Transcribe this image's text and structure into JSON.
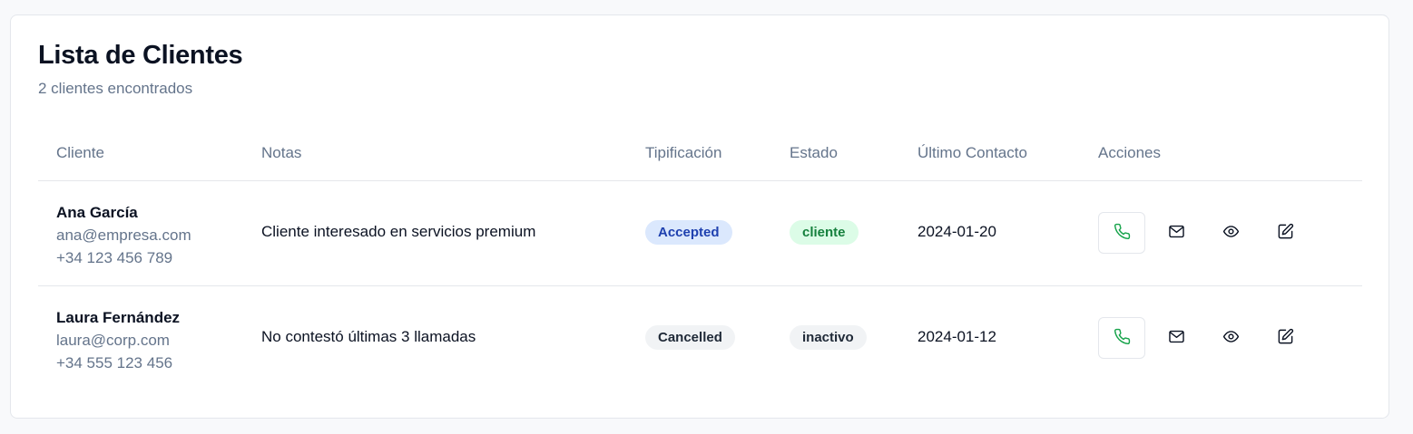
{
  "header": {
    "title": "Lista de Clientes",
    "subtitle": "2 clientes encontrados"
  },
  "table": {
    "columns": [
      "Cliente",
      "Notas",
      "Tipificación",
      "Estado",
      "Último Contacto",
      "Acciones"
    ],
    "rows": [
      {
        "name": "Ana García",
        "email": "ana@empresa.com",
        "phone": "+34 123 456 789",
        "notes": "Cliente interesado en servicios premium",
        "tipificacion": "Accepted",
        "estado": "cliente",
        "ultimo_contacto": "2024-01-20"
      },
      {
        "name": "Laura Fernández",
        "email": "laura@corp.com",
        "phone": "+34 555 123 456",
        "notes": "No contestó últimas 3 llamadas",
        "tipificacion": "Cancelled",
        "estado": "inactivo",
        "ultimo_contacto": "2024-01-12"
      }
    ]
  },
  "actions": [
    {
      "icon": "phone-icon",
      "color": "#16a34a"
    },
    {
      "icon": "mail-icon",
      "color": "#0b1222"
    },
    {
      "icon": "eye-icon",
      "color": "#0b1222"
    },
    {
      "icon": "edit-icon",
      "color": "#0b1222"
    }
  ],
  "badge_colors": {
    "Accepted": {
      "bg": "#dbe8fd",
      "fg": "#1e40af"
    },
    "Cancelled": {
      "bg": "#f1f3f5",
      "fg": "#1f2937"
    },
    "cliente": {
      "bg": "#dcfce7",
      "fg": "#15803d"
    },
    "inactivo": {
      "bg": "#f1f3f5",
      "fg": "#1f2937"
    }
  }
}
